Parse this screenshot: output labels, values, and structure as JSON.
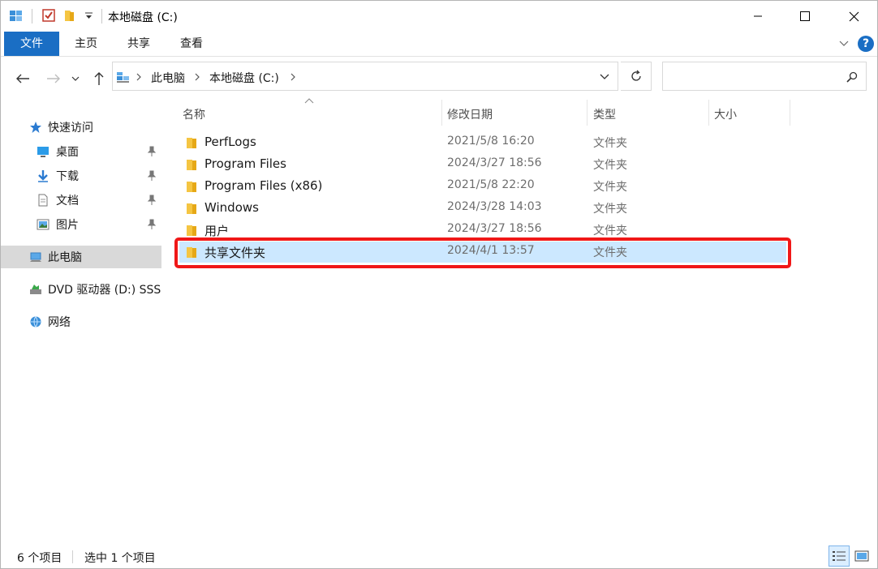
{
  "window": {
    "title": "本地磁盘 (C:)"
  },
  "ribbon": {
    "tabs": [
      {
        "label": "文件"
      },
      {
        "label": "主页"
      },
      {
        "label": "共享"
      },
      {
        "label": "查看"
      }
    ],
    "help_label": "?"
  },
  "address": {
    "crumbs": [
      "此电脑",
      "本地磁盘 (C:)"
    ]
  },
  "search": {
    "placeholder": ""
  },
  "sidebar": {
    "items": [
      {
        "label": "快速访问",
        "icon": "star-icon"
      },
      {
        "label": "桌面",
        "icon": "desktop-icon"
      },
      {
        "label": "下载",
        "icon": "download-icon"
      },
      {
        "label": "文档",
        "icon": "document-icon"
      },
      {
        "label": "图片",
        "icon": "pictures-icon"
      },
      {
        "label": "此电脑",
        "icon": "computer-icon"
      },
      {
        "label": "DVD 驱动器 (D:) SSS",
        "icon": "dvd-drive-icon"
      },
      {
        "label": "网络",
        "icon": "network-icon"
      }
    ]
  },
  "columns": {
    "name": "名称",
    "date": "修改日期",
    "type": "类型",
    "size": "大小"
  },
  "files": [
    {
      "name": "PerfLogs",
      "date": "2021/5/8 16:20",
      "type": "文件夹"
    },
    {
      "name": "Program Files",
      "date": "2024/3/27 18:56",
      "type": "文件夹"
    },
    {
      "name": "Program Files (x86)",
      "date": "2021/5/8 22:20",
      "type": "文件夹"
    },
    {
      "name": "Windows",
      "date": "2024/3/28 14:03",
      "type": "文件夹"
    },
    {
      "name": "用户",
      "date": "2024/3/27 18:56",
      "type": "文件夹"
    },
    {
      "name": "共享文件夹",
      "date": "2024/4/1 13:57",
      "type": "文件夹"
    }
  ],
  "status": {
    "item_count": "6 个项目",
    "selected_count": "选中 1 个项目"
  },
  "colors": {
    "accent": "#1a6ec4",
    "selection": "#cce8ff",
    "highlight": "#f01818",
    "folder": "#f5c542"
  }
}
